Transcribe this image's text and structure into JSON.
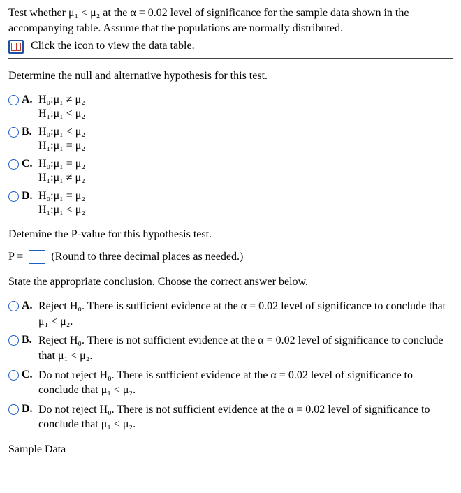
{
  "intro": {
    "line": "Test whether μ₁ < μ₂ at the α = 0.02 level of significance for the sample data shown in the accompanying table. Assume that the populations are normally distributed.",
    "click_text": "Click the icon to view the data table."
  },
  "q1": {
    "prompt": "Determine the null and alternative hypothesis for this test.",
    "options": {
      "A": {
        "letter": "A.",
        "h0": "H₀:μ₁ ≠ μ₂",
        "h1": "H₁:μ₁ < μ₂"
      },
      "B": {
        "letter": "B.",
        "h0": "H₀:μ₁ < μ₂",
        "h1": "H₁:μ₁ = μ₂"
      },
      "C": {
        "letter": "C.",
        "h0": "H₀:μ₁ = μ₂",
        "h1": "H₁:μ₁ ≠ μ₂"
      },
      "D": {
        "letter": "D.",
        "h0": "H₀:μ₁ = μ₂",
        "h1": "H₁:μ₁ < μ₂"
      }
    }
  },
  "q2": {
    "prompt": "Detemine the P-value for this hypothesis test.",
    "p_prefix": "P =",
    "hint": "(Round to three decimal places as needed.)"
  },
  "q3": {
    "prompt": "State the appropriate conclusion. Choose the correct answer below.",
    "options": {
      "A": {
        "letter": "A.",
        "text": "Reject H₀. There is sufficient evidence at the α = 0.02 level of significance to conclude that μ₁ < μ₂."
      },
      "B": {
        "letter": "B.",
        "text": "Reject H₀. There is not sufficient evidence at the α = 0.02 level of significance to conclude that μ₁ < μ₂."
      },
      "C": {
        "letter": "C.",
        "text": "Do not reject H₀. There is sufficient evidence at the α = 0.02 level of significance to conclude that μ₁ < μ₂."
      },
      "D": {
        "letter": "D.",
        "text": "Do not reject H₀. There is not sufficient evidence at the α = 0.02 level of significance to conclude that μ₁ < μ₂."
      }
    }
  },
  "sample_heading": "Sample Data"
}
